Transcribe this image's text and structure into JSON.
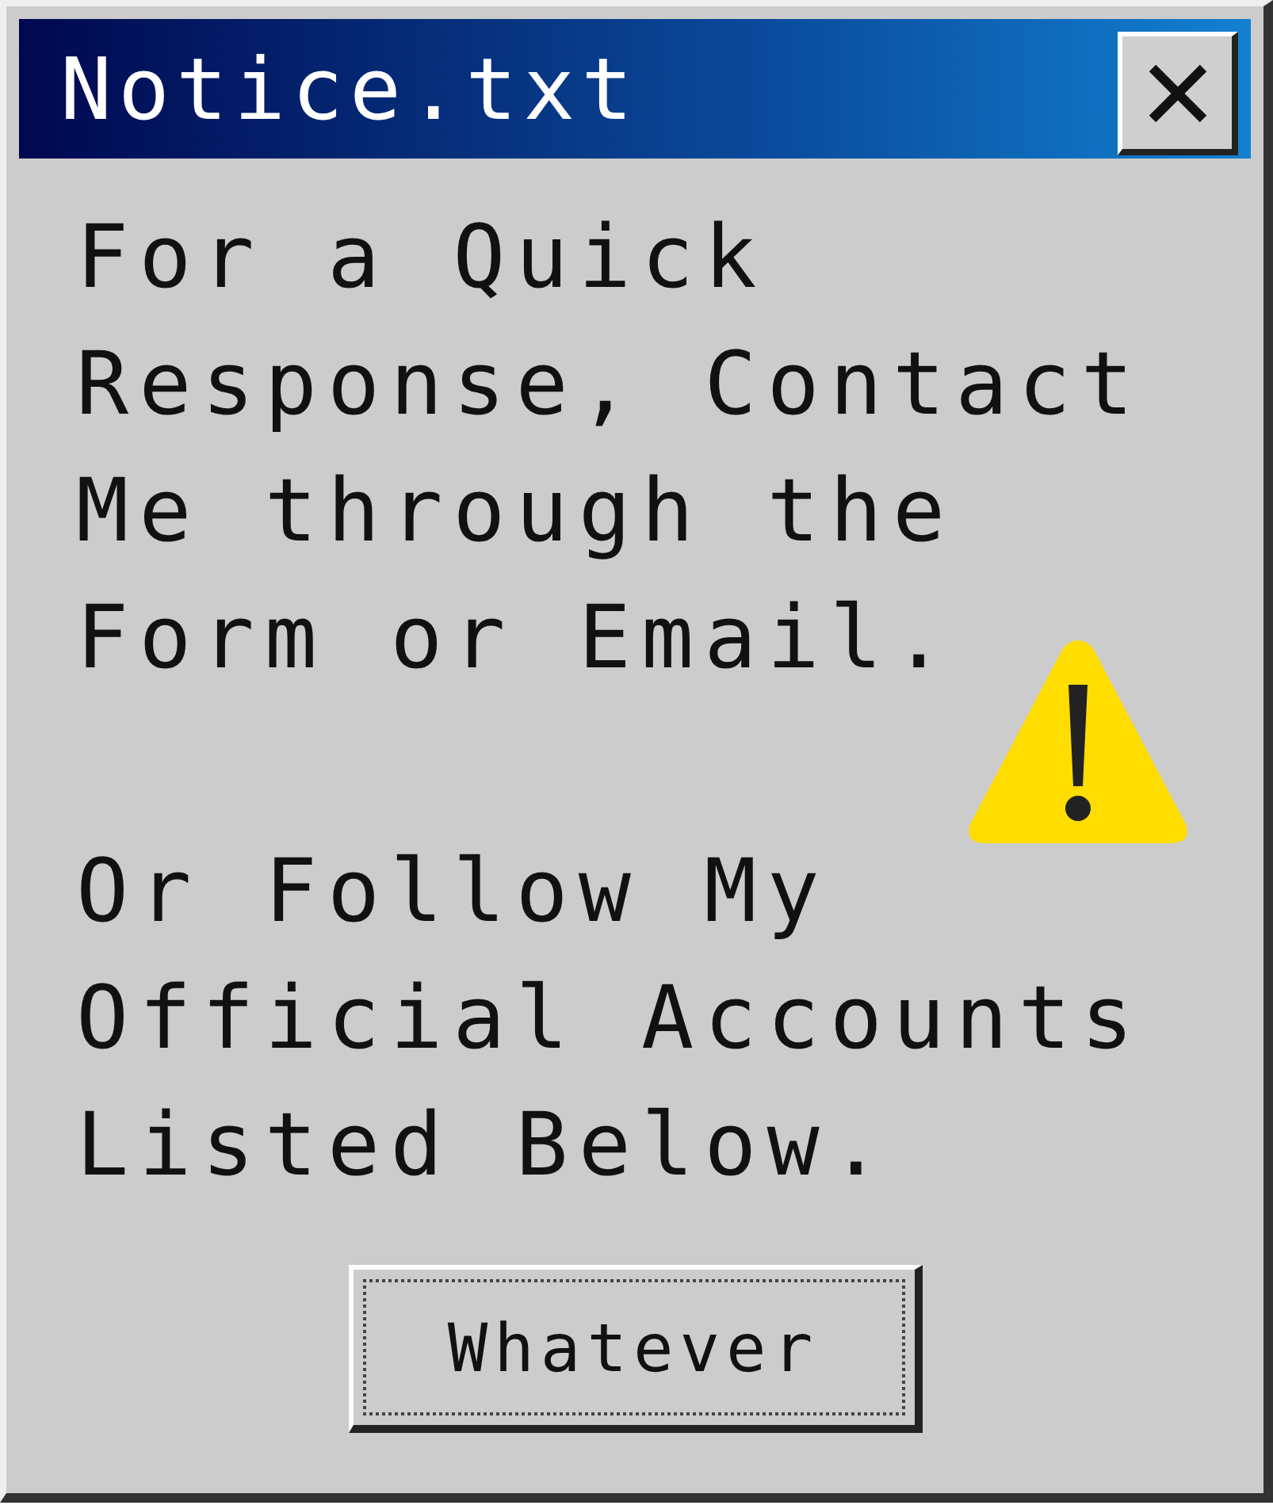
{
  "window": {
    "title": "Notice.txt"
  },
  "message": [
    "For a Quick Response, Contact Me through the Form or Email.",
    "Or Follow My Official Accounts Listed Below."
  ],
  "buttons": [
    {
      "label": "Whatever",
      "focused": true
    }
  ]
}
